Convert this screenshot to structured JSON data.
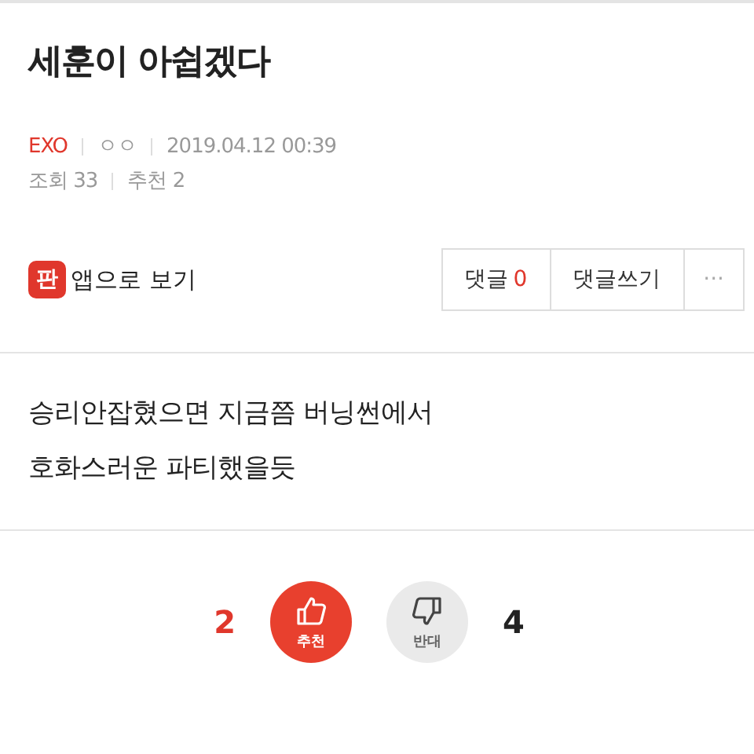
{
  "title": "세훈이 아쉽겠다",
  "meta": {
    "board": "EXO",
    "author": "ㅇㅇ",
    "date": "2019.04.12 00:39",
    "views": "조회 33",
    "recommends": "추천 2"
  },
  "app_link": {
    "badge": "판",
    "label": "앱으로 보기"
  },
  "actions": {
    "comments_label": "댓글",
    "comments_count": "0",
    "write": "댓글쓰기",
    "more": "···"
  },
  "body": [
    "승리안잡혔으면 지금쯤 버닝썬에서",
    "호화스러운 파티했을듯"
  ],
  "votes": [
    {
      "kind": "up",
      "count": "2",
      "label": "추천",
      "selected": true
    },
    {
      "kind": "down",
      "count": "4",
      "label": "반대",
      "selected": false
    }
  ]
}
